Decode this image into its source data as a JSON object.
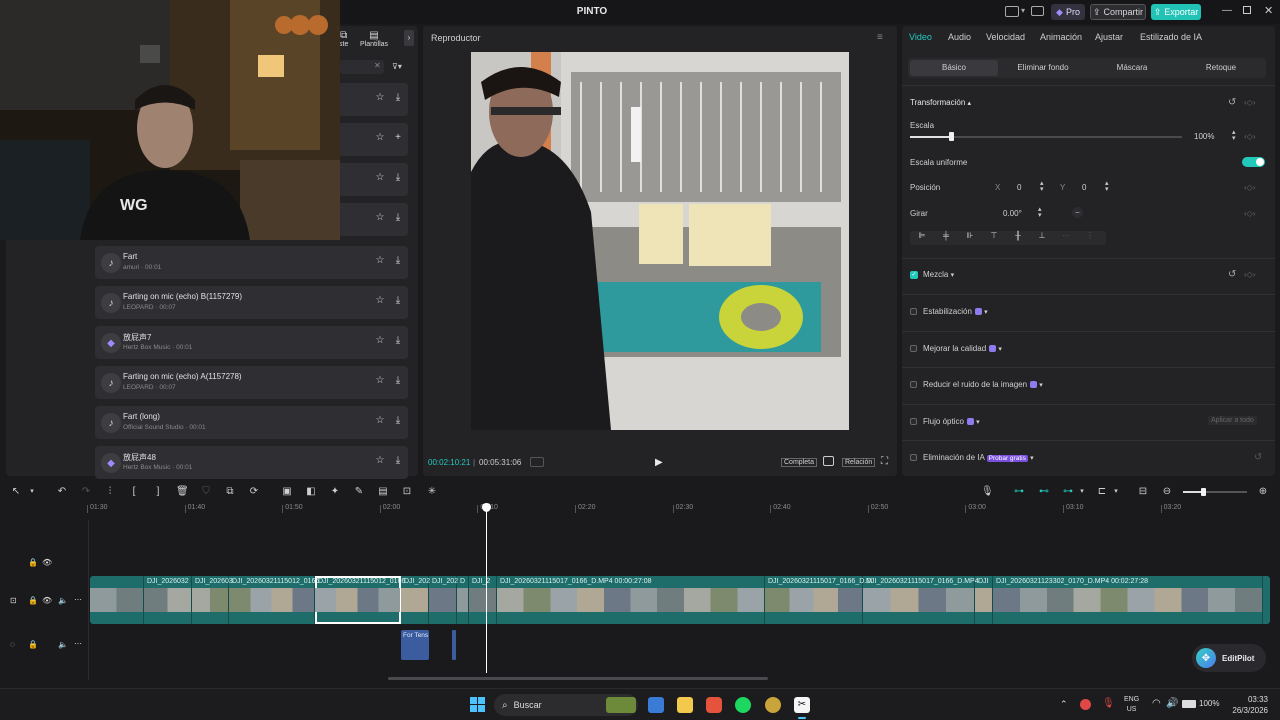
{
  "titlebar": {
    "title": "PINTO",
    "pro_label": "Pro",
    "share_label": "Compartir",
    "export_label": "Exportar"
  },
  "media": {
    "tab_partial": "ste",
    "tab_templates": "Plantillas",
    "sounds": [
      {
        "title": "Fart",
        "meta": "amuri · 00:01",
        "icon": "music-note-icon"
      },
      {
        "title": "Farting on mic (echo) B(1157279)",
        "meta": "LEOPARD · 00:07",
        "icon": "music-note-icon"
      },
      {
        "title": "放屁声7",
        "meta": "Hertz Box Music · 00:01",
        "icon": "ai-gem-icon"
      },
      {
        "title": "Farting on mic (echo) A(1157278)",
        "meta": "LEOPARD · 00:07",
        "icon": "music-note-icon"
      },
      {
        "title": "Fart (long)",
        "meta": "Official Sound Studio · 00:01",
        "icon": "music-note-icon"
      },
      {
        "title": "放屁声48",
        "meta": "Hertz Box Music · 00:01",
        "icon": "ai-gem-icon"
      }
    ]
  },
  "player": {
    "title": "Reproductor",
    "current_time": "00:02:10:21",
    "total_time": "00:05:31:06",
    "full_label": "Completa",
    "ratio_label": "Relación"
  },
  "props": {
    "tabs": [
      "Video",
      "Audio",
      "Velocidad",
      "Animación",
      "Ajustar",
      "Estilizado de IA"
    ],
    "subtabs": [
      "Básico",
      "Eliminar fondo",
      "Máscara",
      "Retoque"
    ],
    "transform_label": "Transformación",
    "scale_label": "Escala",
    "scale_value": "100%",
    "scale_fraction": 0.15,
    "uniform_label": "Escala uniforme",
    "position_label": "Posición",
    "pos_x_label": "X",
    "pos_x": "0",
    "pos_y_label": "Y",
    "pos_y": "0",
    "rotate_label": "Girar",
    "rotate_value": "0.00°",
    "blend_label": "Mezcla",
    "stabilize_label": "Estabilización",
    "quality_label": "Mejorar la calidad",
    "noise_label": "Reducir el ruido de la imagen",
    "flow_label": "Flujo óptico",
    "apply_all_label": "Aplicar a todo",
    "ai_remove_label": "Eliminación de IA",
    "try_free_label": "Probar gratis"
  },
  "timeline": {
    "ticks": [
      "01:30",
      "01:40",
      "01:50",
      "02:00",
      "02:10",
      "02:20",
      "02:30",
      "02:40",
      "02:50",
      "03:00",
      "03:10",
      "03:20"
    ],
    "clips": [
      {
        "label": "",
        "w": 54
      },
      {
        "label": "DJI_2026032",
        "w": 48
      },
      {
        "label": "DJI_202603",
        "w": 37
      },
      {
        "label": "DJI_20260321115012_0166",
        "w": 86
      },
      {
        "label": "DJI_20260321115012_0166",
        "w": 86,
        "selected": true
      },
      {
        "label": "DJI_202",
        "w": 28
      },
      {
        "label": "DJI_202",
        "w": 28
      },
      {
        "label": "D",
        "w": 12
      },
      {
        "label": "DJI_2",
        "w": 28
      },
      {
        "label": "DJI_20260321115017_0166_D.MP4  00:00:27:08",
        "w": 268
      },
      {
        "label": "DJI_20260321115017_0166_D.M",
        "w": 98
      },
      {
        "label": "DJI_20260321115017_0166_D.MP4",
        "w": 112
      },
      {
        "label": "DJI",
        "w": 18
      },
      {
        "label": "DJI_20260321123302_0170_D.MP4  00:02:27:28",
        "w": 270
      }
    ],
    "audio_clip_label": "For Tens"
  },
  "editpilot_label": "EditPilot",
  "taskbar": {
    "search_placeholder": "Buscar",
    "lang": "ENG",
    "region": "US",
    "battery": "100%",
    "time": "03:33",
    "date": "26/3/2026"
  }
}
